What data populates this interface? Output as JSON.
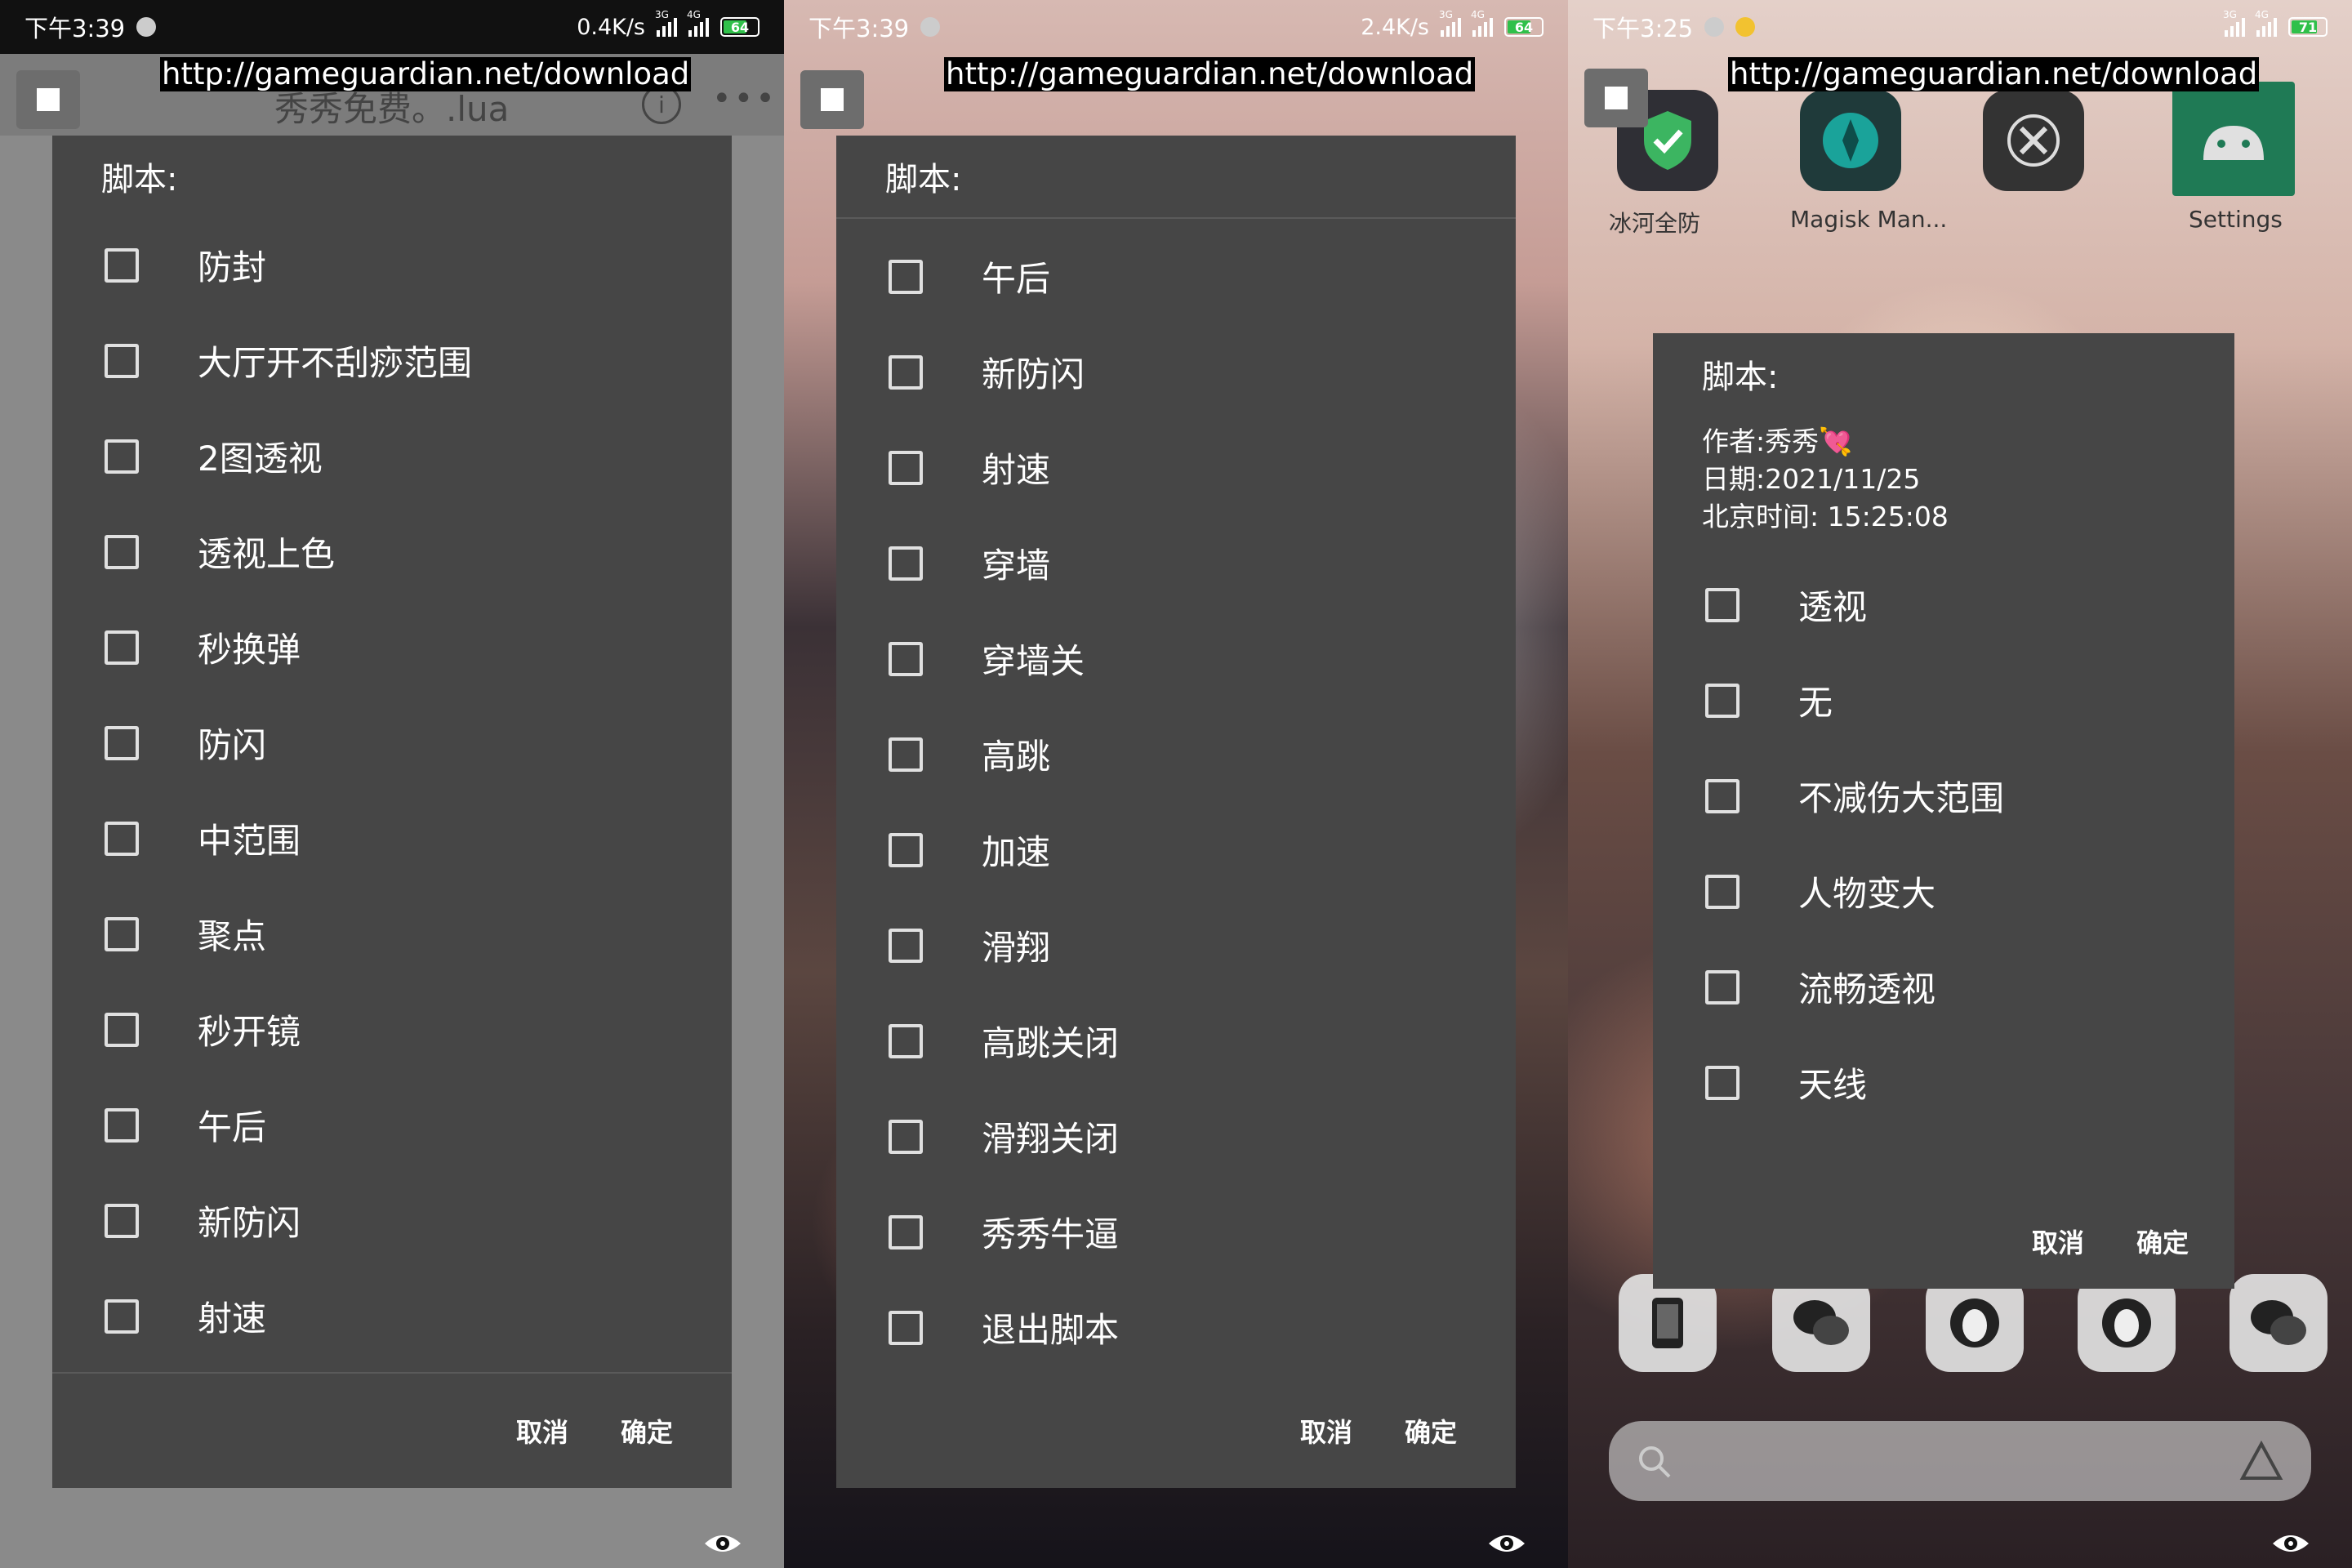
{
  "url": "http://gameguardian.net/download",
  "colors": {
    "dialog_bg": "#464646",
    "panel1_bg": "#8a8a8a",
    "checkbox_border": "#e0e0e0",
    "battery_fill": "#30c04a"
  },
  "panels": [
    {
      "status": {
        "time": "下午3:39",
        "speed": "0.4K/s",
        "battery": "64"
      },
      "header": {
        "title": "秀秀免费。.lua",
        "info_icon": "i",
        "more_icon": "•••"
      },
      "dialog": {
        "title": "脚本:",
        "options": [
          "防封",
          "大厅开不刮痧范围",
          "2图透视",
          "透视上色",
          "秒换弹",
          "防闪",
          "中范围",
          "聚点",
          "秒开镜",
          "午后",
          "新防闪",
          "射速"
        ],
        "cancel": "取消",
        "confirm": "确定"
      }
    },
    {
      "status": {
        "time": "下午3:39",
        "speed": "2.4K/s",
        "battery": "64"
      },
      "dialog": {
        "title": "脚本:",
        "options": [
          "午后",
          "新防闪",
          "射速",
          "穿墙",
          "穿墙关",
          "高跳",
          "加速",
          "滑翔",
          "高跳关闭",
          "滑翔关闭",
          "秀秀牛逼",
          "退出脚本"
        ],
        "cancel": "取消",
        "confirm": "确定"
      }
    },
    {
      "status": {
        "time": "下午3:25",
        "speed": "",
        "battery": "71"
      },
      "home": {
        "apps": [
          {
            "label": "冰河全防",
            "icon": "shield-check-icon"
          },
          {
            "label": "Magisk Man...",
            "icon": "magisk-icon"
          },
          {
            "label": "",
            "icon": "tools-icon"
          },
          {
            "label": "Settings",
            "icon": "android-icon"
          }
        ]
      },
      "dialog": {
        "title": "脚本:",
        "info": [
          "作者:秀秀💘",
          "日期:2021/11/25",
          "北京时间: 15:25:08"
        ],
        "options": [
          "透视",
          "无",
          "不减伤大范围",
          "人物变大",
          "流畅透视",
          "天线"
        ],
        "cancel": "取消",
        "confirm": "确定"
      }
    }
  ]
}
